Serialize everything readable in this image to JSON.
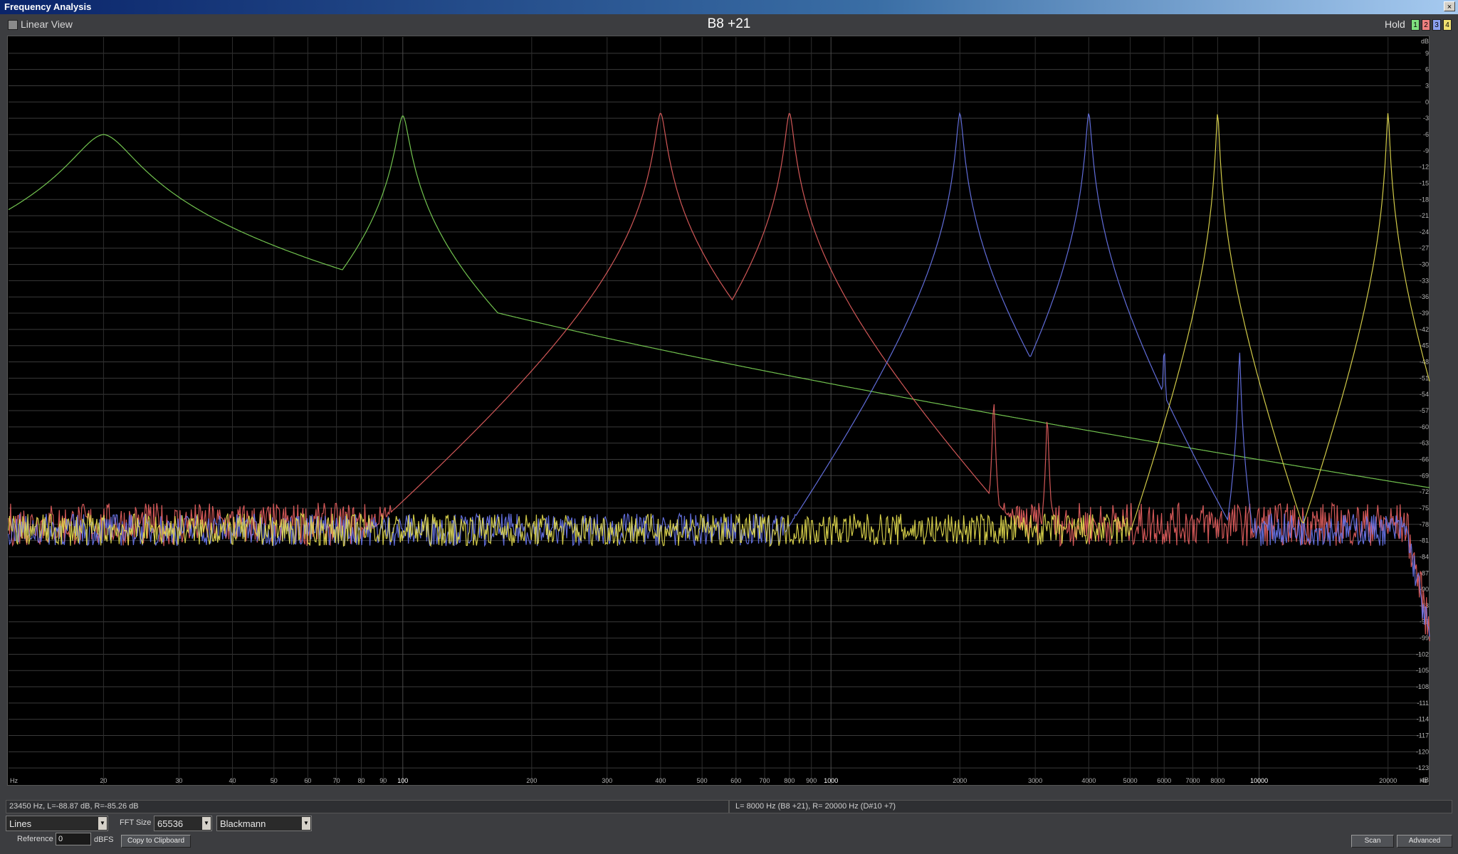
{
  "window": {
    "title": "Frequency Analysis",
    "close": "×"
  },
  "toolbar": {
    "linear_view_label": "Linear View",
    "note_display": "B8 +21",
    "hold_label": "Hold",
    "hold_buttons": [
      {
        "label": "1",
        "color": "#7ee07e"
      },
      {
        "label": "2",
        "color": "#ee8080"
      },
      {
        "label": "3",
        "color": "#8aa0f0"
      },
      {
        "label": "4",
        "color": "#f0e070"
      }
    ]
  },
  "axes": {
    "x_unit": "Hz",
    "x_ticks": [
      {
        "v": 20,
        "l": "20"
      },
      {
        "v": 30,
        "l": "30"
      },
      {
        "v": 40,
        "l": "40"
      },
      {
        "v": 50,
        "l": "50"
      },
      {
        "v": 60,
        "l": "60"
      },
      {
        "v": 70,
        "l": "70"
      },
      {
        "v": 80,
        "l": "80"
      },
      {
        "v": 90,
        "l": "90"
      },
      {
        "v": 100,
        "l": "100"
      },
      {
        "v": 200,
        "l": "200"
      },
      {
        "v": 300,
        "l": "300"
      },
      {
        "v": 400,
        "l": "400"
      },
      {
        "v": 500,
        "l": "500"
      },
      {
        "v": 600,
        "l": "600"
      },
      {
        "v": 700,
        "l": "700"
      },
      {
        "v": 800,
        "l": "800"
      },
      {
        "v": 900,
        "l": "900"
      },
      {
        "v": 1000,
        "l": "1000"
      },
      {
        "v": 2000,
        "l": "2000"
      },
      {
        "v": 3000,
        "l": "3000"
      },
      {
        "v": 4000,
        "l": "4000"
      },
      {
        "v": 5000,
        "l": "5000"
      },
      {
        "v": 6000,
        "l": "6000"
      },
      {
        "v": 7000,
        "l": "7000"
      },
      {
        "v": 8000,
        "l": "8000"
      },
      {
        "v": 10000,
        "l": "10000"
      },
      {
        "v": 20000,
        "l": "20000"
      }
    ],
    "y_unit": "dB",
    "y_ticks": [
      "9",
      "6",
      "3",
      "0",
      "-3",
      "-6",
      "-9",
      "-12",
      "-15",
      "-18",
      "-21",
      "-24",
      "-27",
      "-30",
      "-33",
      "-36",
      "-39",
      "-42",
      "-45",
      "-48",
      "-51",
      "-54",
      "-57",
      "-60",
      "-63",
      "-66",
      "-69",
      "-72",
      "-75",
      "-78",
      "-81",
      "-84",
      "-87",
      "-90",
      "-93",
      "-96",
      "-99",
      "-102",
      "-105",
      "-108",
      "-111",
      "-114",
      "-117",
      "-120",
      "-123"
    ]
  },
  "chart_data": {
    "type": "line",
    "x_scale": "log",
    "x_range": [
      12,
      25000
    ],
    "y_range": [
      -126,
      12
    ],
    "series": [
      {
        "color": "#7ed858",
        "peaks": [
          [
            20,
            -6,
            0.06
          ],
          [
            100,
            -2.5,
            0.012
          ],
          [
            300,
            -50,
            0.002
          ],
          [
            500,
            -60,
            0.002
          ],
          [
            200,
            -56,
            0.002
          ]
        ],
        "noise": -80,
        "noise_amp": 5
      },
      {
        "color": "#e86060",
        "peaks": [
          [
            400,
            -2,
            0.01
          ],
          [
            800,
            -2,
            0.008
          ],
          [
            1200,
            -45,
            0.002
          ],
          [
            1600,
            -55,
            0.002
          ],
          [
            2400,
            -55,
            0.002
          ],
          [
            3200,
            -58,
            0.002
          ]
        ],
        "noise": -78,
        "noise_amp": 4
      },
      {
        "color": "#6a78f0",
        "peaks": [
          [
            2000,
            -2,
            0.006
          ],
          [
            4000,
            -2,
            0.005
          ],
          [
            6000,
            -45,
            0.002
          ],
          [
            9000,
            -46,
            0.002
          ]
        ],
        "noise": -79,
        "noise_amp": 3
      },
      {
        "color": "#e8e050",
        "peaks": [
          [
            8000,
            -2,
            0.003
          ],
          [
            20000,
            -2,
            0.003
          ]
        ],
        "noise": -79,
        "noise_amp": 3
      }
    ]
  },
  "status": {
    "left": "23450 Hz, L=-88.87 dB, R=-85.26 dB",
    "right": "L=  8000 Hz (B8 +21), R=  20000 Hz (D#10 +7)"
  },
  "controls": {
    "display_mode": "Lines",
    "fft_size_label": "FFT Size",
    "fft_size": "65536",
    "window_fn": "Blackmann",
    "reference_label": "Reference",
    "reference_value": "0",
    "reference_unit": "dBFS",
    "copy_button": "Copy to Clipboard",
    "scan_button": "Scan",
    "advanced_button": "Advanced"
  }
}
